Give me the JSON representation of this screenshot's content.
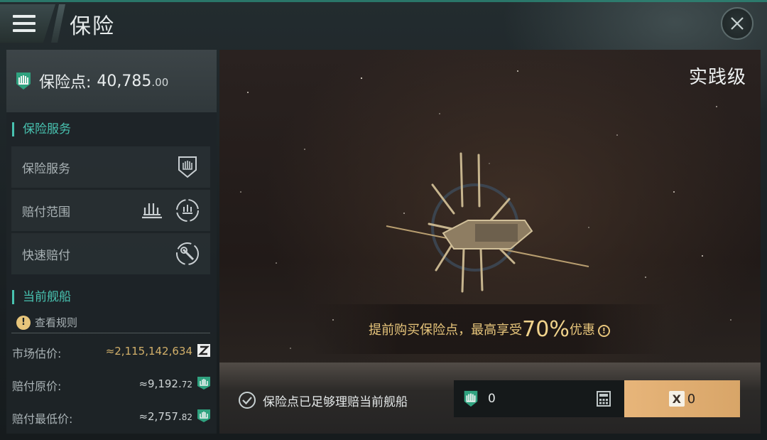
{
  "header": {
    "title": "保险"
  },
  "points": {
    "label": "保险点:",
    "value": "40,785",
    "decimals": ".00"
  },
  "sections": {
    "service_title": "保险服务",
    "ship_title": "当前舰船"
  },
  "services": [
    {
      "label": "保险服务",
      "icons": [
        "shield-badge-icon"
      ]
    },
    {
      "label": "赔付范围",
      "icons": [
        "ship-icons-icon",
        "ship-circle-icon"
      ]
    },
    {
      "label": "快速赔付",
      "icons": [
        "wrench-circle-icon"
      ]
    }
  ],
  "rules": {
    "label": "查看规则"
  },
  "stats": [
    {
      "label": "市场估价:",
      "value": "≈2,115,142,634",
      "decimals": "",
      "unit_icon": "isk-icon",
      "color": "#d2b06a"
    },
    {
      "label": "赔付原价:",
      "value": "≈9,192.",
      "decimals": "72",
      "unit_icon": "insurance-point-icon",
      "color": "#cfd5d6"
    },
    {
      "label": "赔付最低价:",
      "value": "≈2,757.",
      "decimals": "82",
      "unit_icon": "insurance-point-icon",
      "color": "#cfd5d6"
    }
  ],
  "main": {
    "tier": "实践级",
    "promo_prefix": "提前购买保险点，最高享受",
    "promo_pct": "70%",
    "promo_suffix": "优惠"
  },
  "bottom": {
    "check_label": "保险点已足够理赔当前舰船",
    "input_value": "0",
    "buy_value": "0"
  },
  "colors": {
    "accent": "#48c2b0",
    "gold": "#e7c57b",
    "buy_button": "#e7b57a"
  }
}
